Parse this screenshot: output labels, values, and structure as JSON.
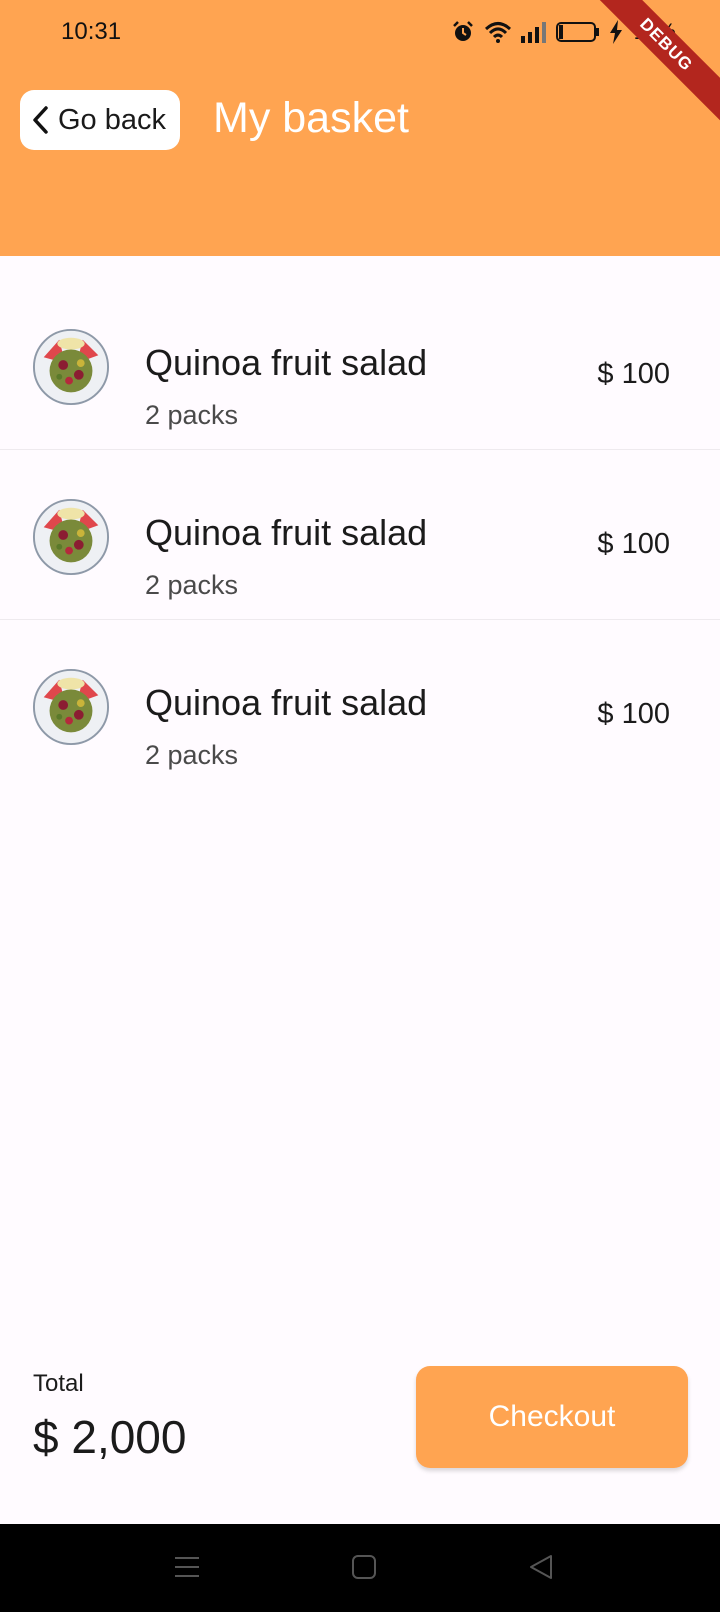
{
  "status_bar": {
    "time": "10:31",
    "battery_percent": "11%",
    "icons": [
      "alarm-icon",
      "wifi-icon",
      "signal-icon",
      "battery-icon",
      "charging-icon"
    ]
  },
  "debug_banner": "DEBUG",
  "header": {
    "back_label": "Go back",
    "title": "My basket",
    "background_color": "#ffa451"
  },
  "basket": {
    "items": [
      {
        "name": "Quinoa fruit salad",
        "quantity": "2 packs",
        "price": "$ 100",
        "image_icon": "fruit-salad-icon"
      },
      {
        "name": "Quinoa fruit salad",
        "quantity": "2 packs",
        "price": "$ 100",
        "image_icon": "fruit-salad-icon"
      },
      {
        "name": "Quinoa fruit salad",
        "quantity": "2 packs",
        "price": "$ 100",
        "image_icon": "fruit-salad-icon"
      }
    ]
  },
  "footer": {
    "total_label": "Total",
    "total_value": "$ 2,000",
    "checkout_label": "Checkout",
    "accent_color": "#ffa451"
  },
  "nav_bar": {
    "buttons": [
      "menu-icon",
      "home-icon",
      "back-icon"
    ]
  }
}
